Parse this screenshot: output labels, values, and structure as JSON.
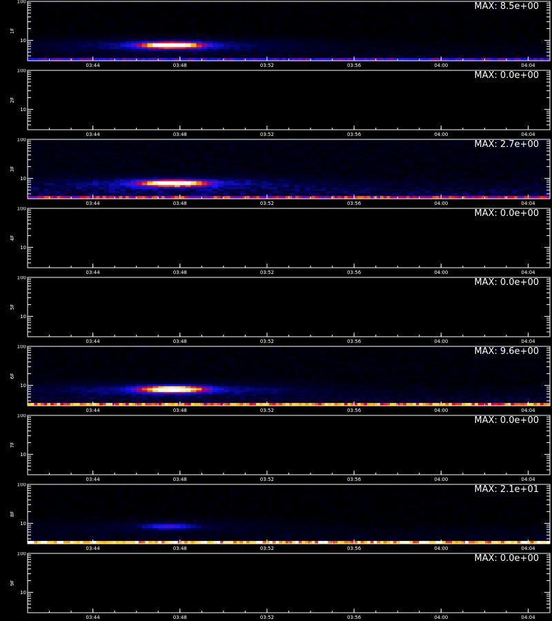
{
  "chart_data": {
    "type": "heatmap",
    "colormap": [
      "#000000",
      "#0000ff",
      "#ff0000",
      "#ffff00",
      "#ffffff"
    ],
    "x_tick_labels": [
      "03:44",
      "03:48",
      "03:52",
      "03:56",
      "04:00",
      "04:04"
    ],
    "x_ticks_minutes": [
      224,
      228,
      232,
      236,
      240,
      244
    ],
    "x_range_minutes": [
      221,
      245
    ],
    "y_scale": "log",
    "y_range": [
      3,
      100
    ],
    "y_tick_labels": [
      "100",
      "10"
    ],
    "footer_text": "",
    "panels": [
      {
        "label": "1F",
        "max_text": "MAX: 8.5e+00",
        "burst": {
          "t": [
            226,
            229.2
          ],
          "f_center": 7.6,
          "peak": 1.0
        },
        "baseline": 0.45,
        "noise": 0.12
      },
      {
        "label": "2F",
        "max_text": "MAX: 0.0e+00",
        "burst": null,
        "baseline": 0,
        "noise": 0
      },
      {
        "label": "3F",
        "max_text": "MAX: 2.7e+00",
        "burst": {
          "t": [
            226,
            229.4
          ],
          "f_center": 7.6,
          "peak": 0.95
        },
        "baseline": 0.62,
        "noise": 0.25
      },
      {
        "label": "4F",
        "max_text": "MAX: 0.0e+00",
        "burst": null,
        "baseline": 0,
        "noise": 0
      },
      {
        "label": "5F",
        "max_text": "MAX: 0.0e+00",
        "burst": null,
        "baseline": 0,
        "noise": 0
      },
      {
        "label": "6F",
        "max_text": "MAX: 9.6e+00",
        "burst": {
          "t": [
            226,
            229.3
          ],
          "f_center": 8.0,
          "peak": 1.0
        },
        "baseline": 0.78,
        "noise": 0.18
      },
      {
        "label": "7F",
        "max_text": "MAX: 0.0e+00",
        "burst": null,
        "baseline": 0,
        "noise": 0
      },
      {
        "label": "8F",
        "max_text": "MAX: 2.1e+01",
        "burst": {
          "t": [
            226,
            229
          ],
          "f_center": 8.5,
          "peak": 0.35
        },
        "baseline": 0.88,
        "noise": 0.12
      },
      {
        "label": "9F",
        "max_text": "MAX: 0.0e+00",
        "burst": null,
        "baseline": 0,
        "noise": 0
      }
    ]
  }
}
